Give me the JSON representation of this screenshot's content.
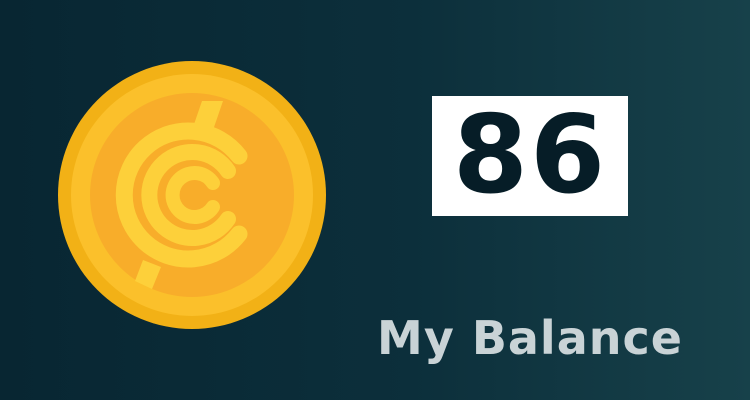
{
  "balance": {
    "value": "86",
    "label": "My Balance"
  },
  "coin": {
    "icon": "coin-icon",
    "colors": {
      "rim": "#f2b116",
      "face": "#fbc02b",
      "emblem": "#fdd03a",
      "inner": "#f8ad2a"
    }
  },
  "theme": {
    "background_start": "#082632",
    "background_end": "#17414a",
    "value_box": "#ffffff",
    "value_text": "#061d27",
    "label_text": "#c9d3d6"
  }
}
